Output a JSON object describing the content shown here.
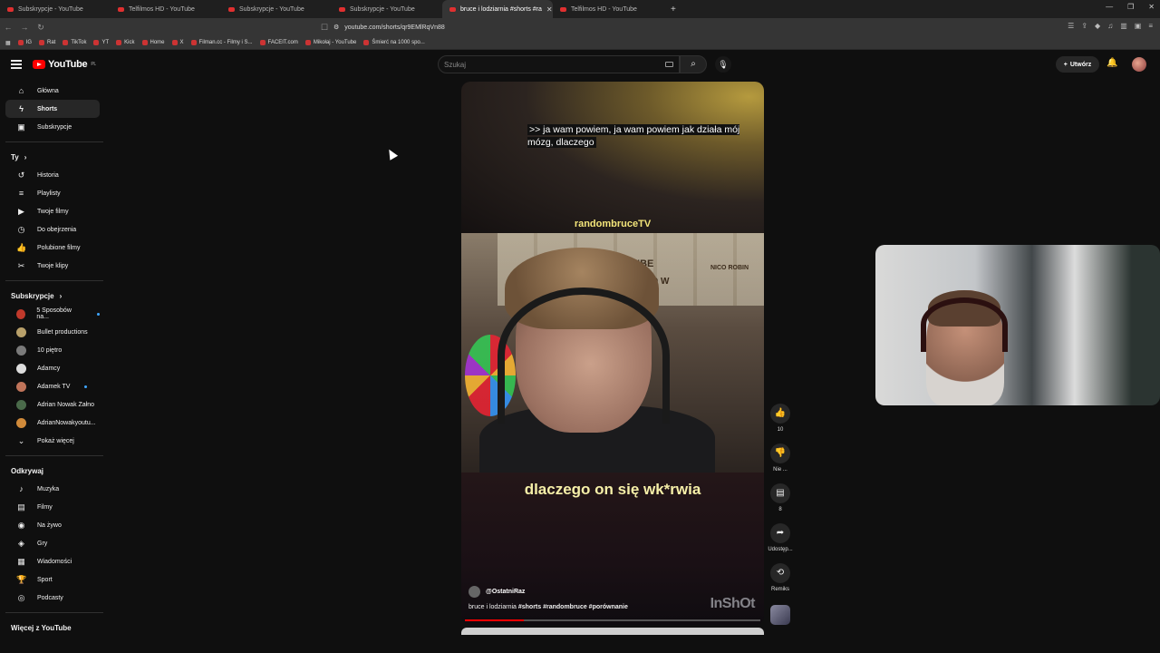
{
  "browser": {
    "tabs": [
      {
        "title": "Subskrypcje - YouTube",
        "active": false
      },
      {
        "title": "Telfilmos HD - YouTube",
        "active": false
      },
      {
        "title": "Subskrypcje - YouTube",
        "active": false
      },
      {
        "title": "Subskrypcje - YouTube",
        "active": false
      },
      {
        "title": "bruce i lodziarnia #shorts #ra",
        "active": true
      },
      {
        "title": "Telfilmos HD - YouTube",
        "active": false
      }
    ],
    "url": "youtube.com/shorts/qr9EMlRqVn88",
    "bookmarks": [
      "IG",
      "Rat",
      "TikTok",
      "YT",
      "Kick",
      "Home",
      "X",
      "Filman.cc - Filmy i S...",
      "FACEIT.com",
      "Mikołaj - YouTube",
      "Śmierć na 1000 spo..."
    ]
  },
  "header": {
    "logo_text": "YouTube",
    "region": "PL",
    "search_placeholder": "Szukaj",
    "create_label": "Utwórz"
  },
  "sidebar": {
    "main": [
      {
        "label": "Główna",
        "icon": "home-icon",
        "active": false
      },
      {
        "label": "Shorts",
        "icon": "shorts-icon",
        "active": true
      },
      {
        "label": "Subskrypcje",
        "icon": "subscriptions-icon",
        "active": false
      }
    ],
    "you_heading": "Ty",
    "you": [
      {
        "label": "Historia",
        "icon": "history-icon"
      },
      {
        "label": "Playlisty",
        "icon": "playlist-icon"
      },
      {
        "label": "Twoje filmy",
        "icon": "your-videos-icon"
      },
      {
        "label": "Do obejrzenia",
        "icon": "watch-later-icon"
      },
      {
        "label": "Polubione filmy",
        "icon": "like-icon"
      },
      {
        "label": "Twoje klipy",
        "icon": "scissors-icon"
      }
    ],
    "subs_heading": "Subskrypcje",
    "subscriptions": [
      {
        "label": "5 Sposobów na...",
        "color": "#c0392b",
        "live": true
      },
      {
        "label": "Bullet productions",
        "color": "#b8a06a",
        "live": false
      },
      {
        "label": "10 piętro",
        "color": "#7a7a7a",
        "live": false
      },
      {
        "label": "Adamcy",
        "color": "#dddddd",
        "live": false
      },
      {
        "label": "Adamek TV",
        "color": "#c0745a",
        "live": true
      },
      {
        "label": "Adrian Nowak Załno",
        "color": "#4a6a4a",
        "live": false
      },
      {
        "label": "AdrianNowakyoutu...",
        "color": "#d08a3a",
        "live": false
      }
    ],
    "show_more": "Pokaż więcej",
    "explore_heading": "Odkrywaj",
    "explore": [
      {
        "label": "Muzyka",
        "icon": "music-icon"
      },
      {
        "label": "Filmy",
        "icon": "film-icon"
      },
      {
        "label": "Na żywo",
        "icon": "live-icon"
      },
      {
        "label": "Gry",
        "icon": "gaming-icon"
      },
      {
        "label": "Wiadomości",
        "icon": "news-icon"
      },
      {
        "label": "Sport",
        "icon": "trophy-icon"
      },
      {
        "label": "Podcasty",
        "icon": "podcast-icon"
      }
    ],
    "more_heading": "Więcej z YouTube"
  },
  "short": {
    "caption": ">> ja wam powiem, ja wam powiem jak działa mój mózg, dlaczego",
    "channel_tag": "randombruceTV",
    "poster_jinbe": "JINBE",
    "poster_wanted": "NTED W",
    "poster_nico": "NICO ROBIN",
    "big_caption": "dlaczego on się wk*rwia",
    "channel": "@OstatniRaz",
    "title_plain": "bruce i lodziarnia ",
    "title_tags": "#shorts #randombruce #porównanie",
    "watermark": "InShOt",
    "progress": 0.2
  },
  "actions": {
    "like_count": "10",
    "dislike_label": "Nie ...",
    "comment_count": "8",
    "share_label": "Udostęp...",
    "remix_label": "Remiks"
  }
}
